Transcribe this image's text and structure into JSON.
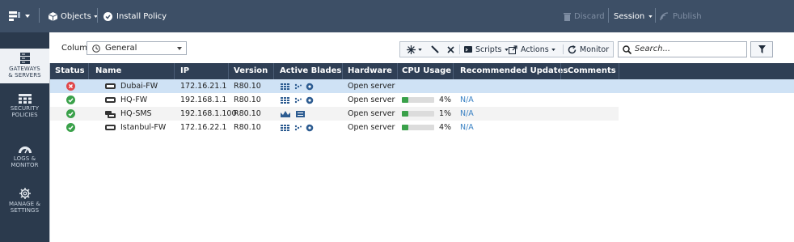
{
  "topbar": {
    "objects_label": "Objects",
    "install_policy_label": "Install Policy",
    "discard_label": "Discard",
    "session_label": "Session",
    "publish_label": "Publish"
  },
  "nav": [
    {
      "line1": "GATEWAYS",
      "line2": "& SERVERS",
      "icon": "gateways-icon",
      "active": true
    },
    {
      "line1": "SECURITY",
      "line2": "POLICIES",
      "icon": "security-policies-icon",
      "active": false
    },
    {
      "line1": "LOGS &",
      "line2": "MONITOR",
      "icon": "logs-monitor-icon",
      "active": false
    },
    {
      "line1": "MANAGE &",
      "line2": "SETTINGS",
      "icon": "gear-icon",
      "active": false
    }
  ],
  "toolbar": {
    "columns_label": "Columns:",
    "columns_value": "General",
    "scripts_label": "Scripts",
    "actions_label": "Actions",
    "monitor_label": "Monitor",
    "search_placeholder": "Search..."
  },
  "table": {
    "headers": [
      "Status",
      "Name",
      "IP",
      "Version",
      "Active Blades",
      "Hardware",
      "CPU Usage",
      "Recommended Updates",
      "Comments"
    ],
    "rows": [
      {
        "status": "error",
        "name": "Dubai-FW",
        "type": "gateway",
        "ip": "172.16.21.1",
        "version": "R80.10",
        "blades": "firewall",
        "hardware": "Open server",
        "cpu": "",
        "cpu_pct": null,
        "updates": "",
        "selected": true
      },
      {
        "status": "ok",
        "name": "HQ-FW",
        "type": "gateway",
        "ip": "192.168.1.1",
        "version": "R80.10",
        "blades": "firewall",
        "hardware": "Open server",
        "cpu": "4%",
        "cpu_pct": 4,
        "updates": "N/A",
        "selected": false
      },
      {
        "status": "ok",
        "name": "HQ-SMS",
        "type": "server",
        "ip": "192.168.1.100",
        "version": "R80.10",
        "blades": "management",
        "hardware": "Open server",
        "cpu": "1%",
        "cpu_pct": 1,
        "updates": "N/A",
        "selected": false
      },
      {
        "status": "ok",
        "name": "Istanbul-FW",
        "type": "gateway",
        "ip": "172.16.22.1",
        "version": "R80.10",
        "blades": "firewall",
        "hardware": "Open server",
        "cpu": "4%",
        "cpu_pct": 4,
        "updates": "N/A",
        "selected": false
      }
    ]
  },
  "colors": {
    "topbar": "#3d4f66",
    "leftnav": "#2b3a4d",
    "header": "#2f3f55",
    "selected_row": "#cfe2f5",
    "ok": "#3aa14a",
    "error": "#e0474a",
    "link": "#3b82c4"
  }
}
